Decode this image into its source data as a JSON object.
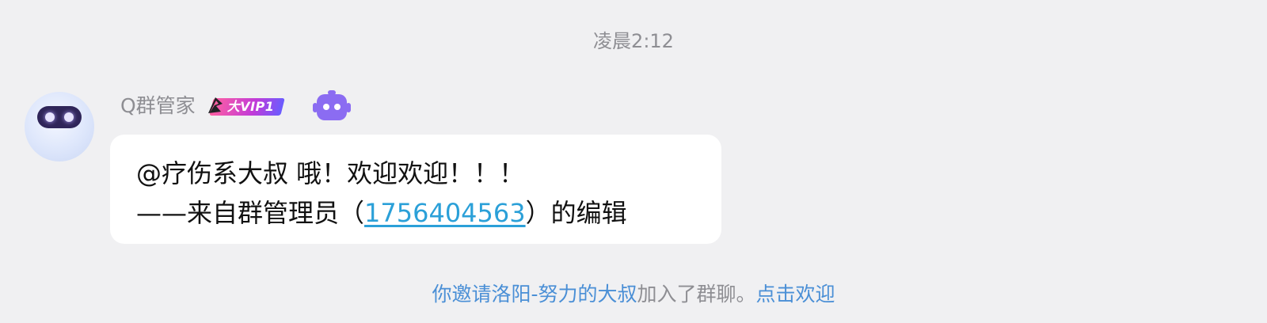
{
  "timestamp": "凌晨2:12",
  "message": {
    "sender_name": "Q群管家",
    "vip_badge_text": "大VIP1",
    "line1": "@疗伤系大叔 哦！欢迎欢迎！！！",
    "line2_prefix": "——来自群管理员（",
    "admin_qq": "1756404563",
    "line2_suffix": "）的编辑"
  },
  "notice": {
    "you_invited": "你邀请",
    "invitee": "洛阳-努力的大叔",
    "joined": "加入了群聊。",
    "welcome_action": "点击欢迎"
  },
  "colors": {
    "background": "#f0f0f2",
    "bubble": "#ffffff",
    "link": "#2ba0d8",
    "notice_link": "#4a8fd6",
    "muted_text": "#8e8e93",
    "bot_icon": "#8b6cf2"
  },
  "icons": {
    "avatar": "robot-avatar-icon",
    "bot": "robot-badge-icon",
    "vip": "vip-badge-icon"
  }
}
